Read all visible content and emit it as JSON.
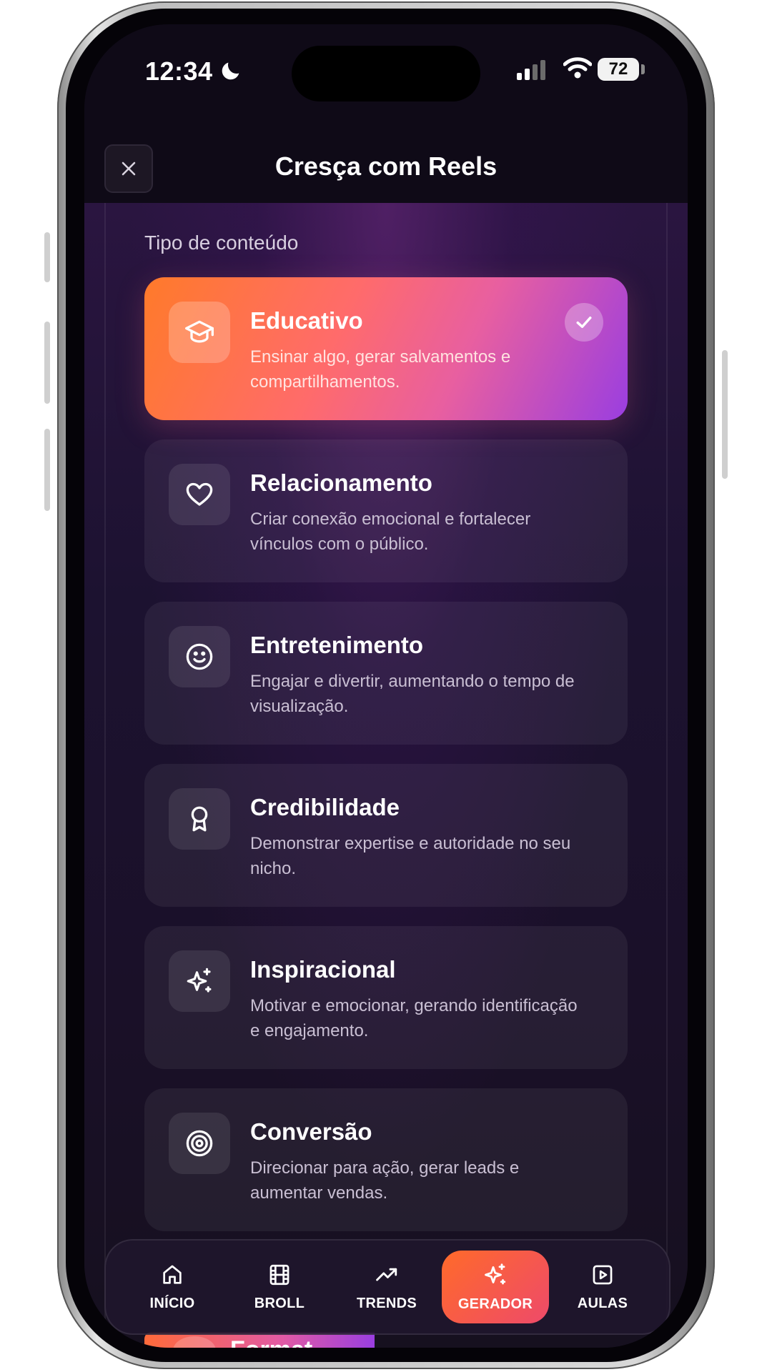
{
  "status_bar": {
    "time": "12:34",
    "battery": "72"
  },
  "header": {
    "title": "Cresça com Reels"
  },
  "section": {
    "label": "Tipo de conteúdo"
  },
  "options": [
    {
      "icon": "graduation-cap-icon",
      "title": "Educativo",
      "description": "Ensinar algo, gerar salvamentos e compartilhamentos.",
      "selected": true
    },
    {
      "icon": "heart-icon",
      "title": "Relacionamento",
      "description": "Criar conexão emocional e fortalecer vínculos com o público.",
      "selected": false
    },
    {
      "icon": "smiley-icon",
      "title": "Entretenimento",
      "description": "Engajar e divertir, aumentando o tempo de visualização.",
      "selected": false
    },
    {
      "icon": "award-icon",
      "title": "Credibilidade",
      "description": "Demonstrar expertise e autoridade no seu nicho.",
      "selected": false
    },
    {
      "icon": "sparkles-icon",
      "title": "Inspiracional",
      "description": "Motivar e emocionar, gerando identificação e engajamento.",
      "selected": false
    },
    {
      "icon": "target-icon",
      "title": "Conversão",
      "description": "Direcionar para ação, gerar leads e aumentar vendas.",
      "selected": false
    }
  ],
  "peek": {
    "label": "Format"
  },
  "tabbar": {
    "items": [
      {
        "icon": "home-icon",
        "label": "INÍCIO",
        "active": false
      },
      {
        "icon": "film-icon",
        "label": "BROLL",
        "active": false
      },
      {
        "icon": "trending-up-icon",
        "label": "TRENDS",
        "active": false
      },
      {
        "icon": "sparkles-icon",
        "label": "GERADOR",
        "active": true
      },
      {
        "icon": "play-square-icon",
        "label": "AULAS",
        "active": false
      }
    ]
  },
  "colors": {
    "accent_start": "#ff7a2a",
    "accent_end": "#9a3ee0",
    "background": "#1c1230"
  }
}
